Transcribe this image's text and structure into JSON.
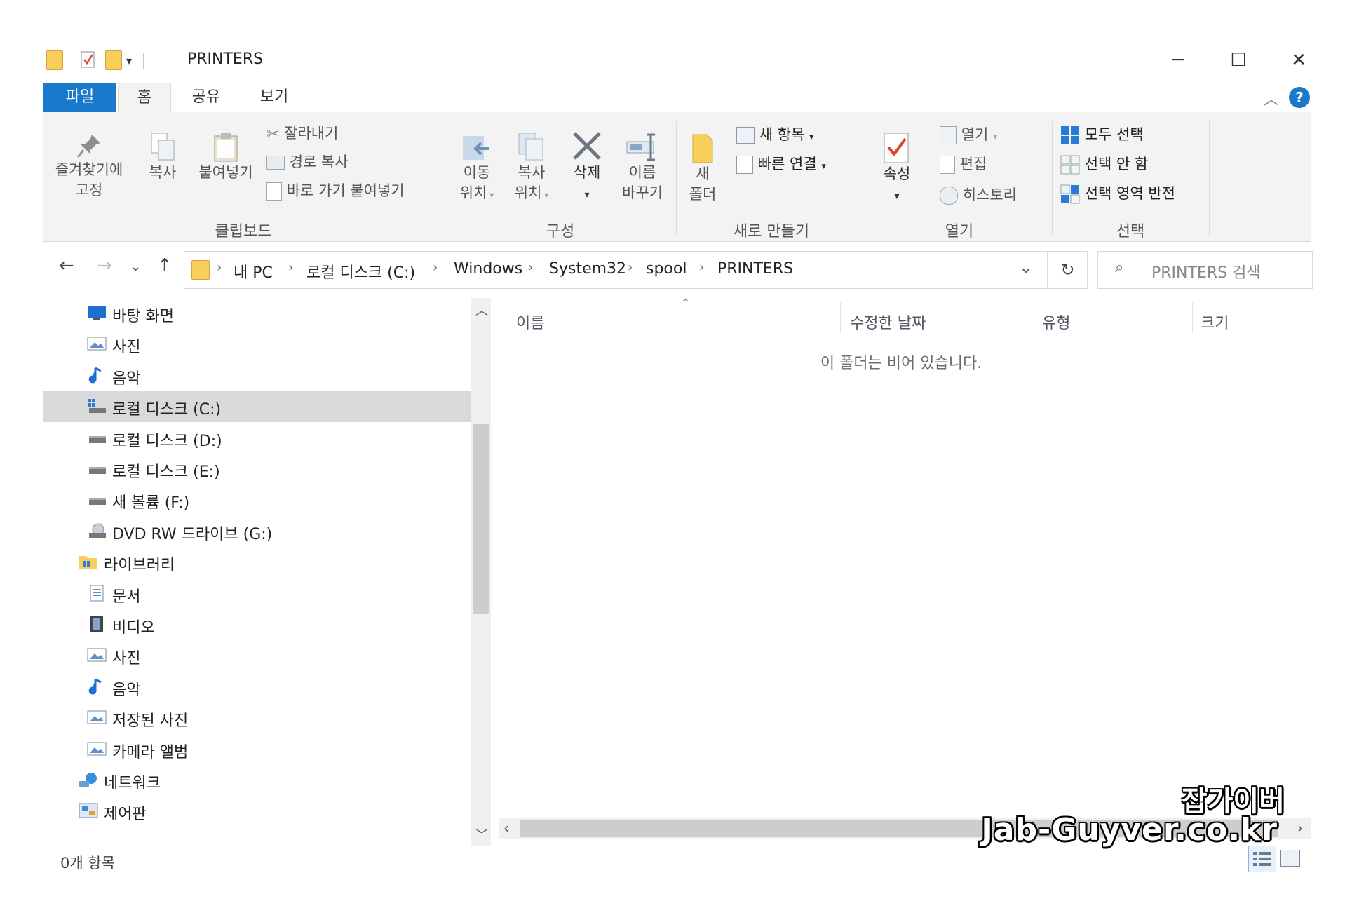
{
  "window": {
    "title": "PRINTERS"
  },
  "tabs": {
    "file": "파일",
    "home": "홈",
    "share": "공유",
    "view": "보기"
  },
  "ribbon": {
    "clipboard": {
      "label": "클립보드",
      "pin": [
        "즐겨찾기에",
        "고정"
      ],
      "copy": "복사",
      "paste": "붙여넣기",
      "cut": "잘라내기",
      "copy_path": "경로 복사",
      "paste_shortcut": "바로 가기 붙여넣기"
    },
    "organize": {
      "label": "구성",
      "move_to": [
        "이동",
        "위치"
      ],
      "copy_to": [
        "복사",
        "위치"
      ],
      "delete": "삭제",
      "rename": [
        "이름",
        "바꾸기"
      ]
    },
    "new": {
      "label": "새로 만들기",
      "new_folder": [
        "새",
        "폴더"
      ],
      "new_item": "새 항목",
      "easy_access": "빠른 연결"
    },
    "open": {
      "label": "열기",
      "properties": "속성",
      "open": "열기",
      "edit": "편집",
      "history": "히스토리"
    },
    "select": {
      "label": "선택",
      "select_all": "모두 선택",
      "select_none": "선택 안 함",
      "invert": "선택 영역 반전"
    }
  },
  "address": {
    "crumbs": [
      "내 PC",
      "로컬 디스크 (C:)",
      "Windows",
      "System32",
      "spool",
      "PRINTERS"
    ],
    "search_placeholder": "PRINTERS 검색"
  },
  "nav_tree": [
    {
      "label": "바탕 화면",
      "icon": "desktop-icon",
      "indent": 1
    },
    {
      "label": "사진",
      "icon": "pictures-icon",
      "indent": 1
    },
    {
      "label": "음악",
      "icon": "music-icon",
      "indent": 1
    },
    {
      "label": "로컬 디스크 (C:)",
      "icon": "system-drive-icon",
      "indent": 1,
      "selected": true
    },
    {
      "label": "로컬 디스크 (D:)",
      "icon": "drive-icon",
      "indent": 1
    },
    {
      "label": "로컬 디스크 (E:)",
      "icon": "drive-icon",
      "indent": 1
    },
    {
      "label": "새 볼륨 (F:)",
      "icon": "drive-icon",
      "indent": 1
    },
    {
      "label": "DVD RW 드라이브 (G:)",
      "icon": "dvd-drive-icon",
      "indent": 1
    },
    {
      "label": "라이브러리",
      "icon": "library-icon",
      "indent": 0
    },
    {
      "label": "문서",
      "icon": "documents-icon",
      "indent": 1
    },
    {
      "label": "비디오",
      "icon": "videos-icon",
      "indent": 1
    },
    {
      "label": "사진",
      "icon": "pictures-icon",
      "indent": 1
    },
    {
      "label": "음악",
      "icon": "music-icon",
      "indent": 1
    },
    {
      "label": "저장된 사진",
      "icon": "pictures-icon",
      "indent": 1
    },
    {
      "label": "카메라 앨범",
      "icon": "pictures-icon",
      "indent": 1
    },
    {
      "label": "네트워크",
      "icon": "network-icon",
      "indent": 0
    },
    {
      "label": "제어판",
      "icon": "control-panel-icon",
      "indent": 0
    }
  ],
  "columns": {
    "name": "이름",
    "date": "수정한 날짜",
    "type": "유형",
    "size": "크기"
  },
  "content": {
    "empty_message": "이 폴더는 비어 있습니다."
  },
  "status": {
    "item_count": "0개 항목"
  },
  "watermark": {
    "line1": "잡가이버",
    "line2": "Jab-Guyver.co.kr"
  }
}
